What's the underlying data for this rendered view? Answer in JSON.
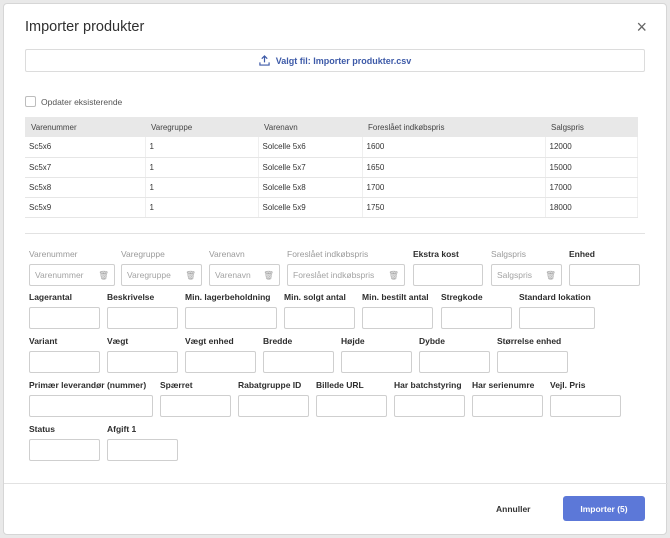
{
  "modal": {
    "title": "Importer produkter",
    "close": "×",
    "file_label": "Valgt fil: Importer produkter.csv",
    "update_existing": "Opdater eksisterende"
  },
  "table": {
    "headers": [
      "Varenummer",
      "Varegruppe",
      "Varenavn",
      "Foreslået indkøbspris",
      "Salgspris"
    ],
    "rows": [
      [
        "Sc5x6",
        "1",
        "Solcelle 5x6",
        "1600",
        "12000"
      ],
      [
        "Sc5x7",
        "1",
        "Solcelle 5x7",
        "1650",
        "15000"
      ],
      [
        "Sc5x8",
        "1",
        "Solcelle 5x8",
        "1700",
        "17000"
      ],
      [
        "Sc5x9",
        "1",
        "Solcelle 5x9",
        "1750",
        "18000"
      ]
    ]
  },
  "fields": {
    "mapped": [
      {
        "label": "Varenummer",
        "value": "Varenummer"
      },
      {
        "label": "Varegruppe",
        "value": "Varegruppe"
      },
      {
        "label": "Varenavn",
        "value": "Varenavn"
      },
      {
        "label": "Foreslået indkøbspris",
        "value": "Foreslået indkøbspris"
      },
      {
        "label": "Salgspris",
        "value": "Salgspris"
      }
    ],
    "ekstra_kost": "Ekstra kost",
    "enhed": "Enhed",
    "row2": [
      "Lagerantal",
      "Beskrivelse",
      "Min. lagerbeholdning",
      "Min. solgt antal",
      "Min. bestilt antal",
      "Stregkode",
      "Standard lokation"
    ],
    "row3": [
      "Variant",
      "Vægt",
      "Vægt enhed",
      "Bredde",
      "Højde",
      "Dybde",
      "Størrelse enhed"
    ],
    "row4": [
      "Primær leverandør (nummer)",
      "Spærret",
      "Rabatgruppe ID",
      "Billede URL",
      "Har batchstyring",
      "Har serienumre",
      "Vejl. Pris"
    ],
    "row5": [
      "Status",
      "Afgift 1"
    ]
  },
  "footer": {
    "cancel": "Annuller",
    "import": "Importer (5)"
  },
  "colors": {
    "accent": "#5c78d8",
    "link": "#3d5aa8"
  }
}
